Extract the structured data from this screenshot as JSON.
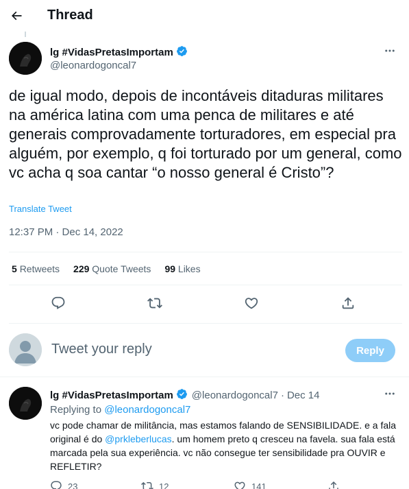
{
  "header": {
    "title": "Thread"
  },
  "main_tweet": {
    "author_name": "lg #VidasPretasImportam",
    "handle": "@leonardogoncal7",
    "text": "de igual modo, depois de incontáveis ditaduras militares na américa latina com uma penca de militares e até generais comprovadamente torturadores, em especial pra alguém, por exemplo, q foi torturado por um general, como vc acha q soa cantar “o nosso general é Cristo”?",
    "translate_label": "Translate Tweet",
    "timestamp": "12:37 PM · Dec 14, 2022",
    "stats": {
      "retweets_count": "5",
      "retweets_label": "Retweets",
      "quotes_count": "229",
      "quotes_label": "Quote Tweets",
      "likes_count": "99",
      "likes_label": "Likes"
    }
  },
  "composer": {
    "placeholder": "Tweet your reply",
    "button_label": "Reply"
  },
  "reply_tweet": {
    "author_name": "lg #VidasPretasImportam",
    "handle": "@leonardogoncal7",
    "separator": "·",
    "date": "Dec 14",
    "replying_to_label": "Replying to",
    "replying_to_handle": "@leonardogoncal7",
    "text_part1": "vc pode chamar de militância, mas estamos falando de SENSIBILIDADE. e a fala original é do ",
    "mention": "@prkleberlucas",
    "text_part2": ". um homem preto q cresceu na favela. sua fala está marcada pela sua experiência. vc não consegue ter sensibilidade pra OUVIR e REFLETIR?",
    "reply_count": "23",
    "retweet_count": "12",
    "like_count": "141"
  },
  "colors": {
    "accent": "#1d9bf0",
    "text": "#0f1419",
    "muted": "#536471",
    "reply_button": "#8ecdf8",
    "verified": "#1d9bf0"
  }
}
